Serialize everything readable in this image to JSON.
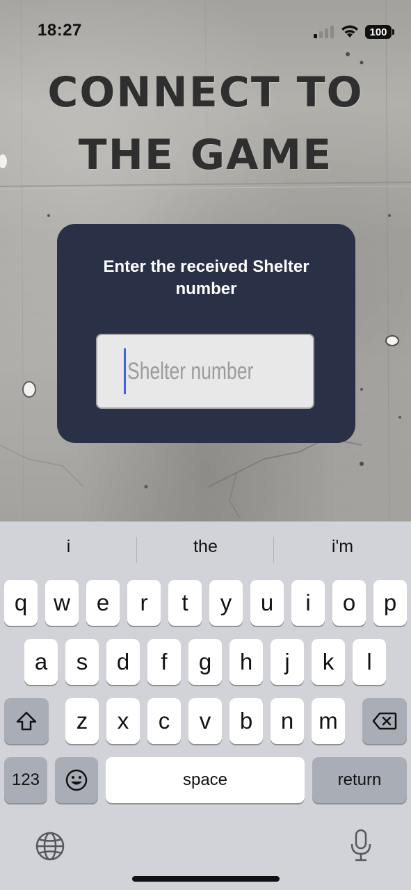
{
  "status_bar": {
    "time": "18:27",
    "battery": "100"
  },
  "title": {
    "line1": "CONNECT TO",
    "line2": "THE GAME"
  },
  "dialog": {
    "prompt": "Enter the received Shelter number",
    "input_placeholder": "Shelter number",
    "input_value": ""
  },
  "keyboard": {
    "suggestions": [
      "i",
      "the",
      "i'm"
    ],
    "row1": [
      "q",
      "w",
      "e",
      "r",
      "t",
      "y",
      "u",
      "i",
      "o",
      "p"
    ],
    "row2": [
      "a",
      "s",
      "d",
      "f",
      "g",
      "h",
      "j",
      "k",
      "l"
    ],
    "row3": [
      "z",
      "x",
      "c",
      "v",
      "b",
      "n",
      "m"
    ],
    "numbers_label": "123",
    "space_label": "space",
    "return_label": "return"
  },
  "colors": {
    "card_background": "#2a3046",
    "caret": "#3f63e6",
    "keyboard_background": "#d1d3d9"
  },
  "icons": [
    "cellular-signal-icon",
    "wifi-icon",
    "battery-icon",
    "shift-icon",
    "backspace-icon",
    "emoji-icon",
    "globe-icon",
    "microphone-icon"
  ]
}
